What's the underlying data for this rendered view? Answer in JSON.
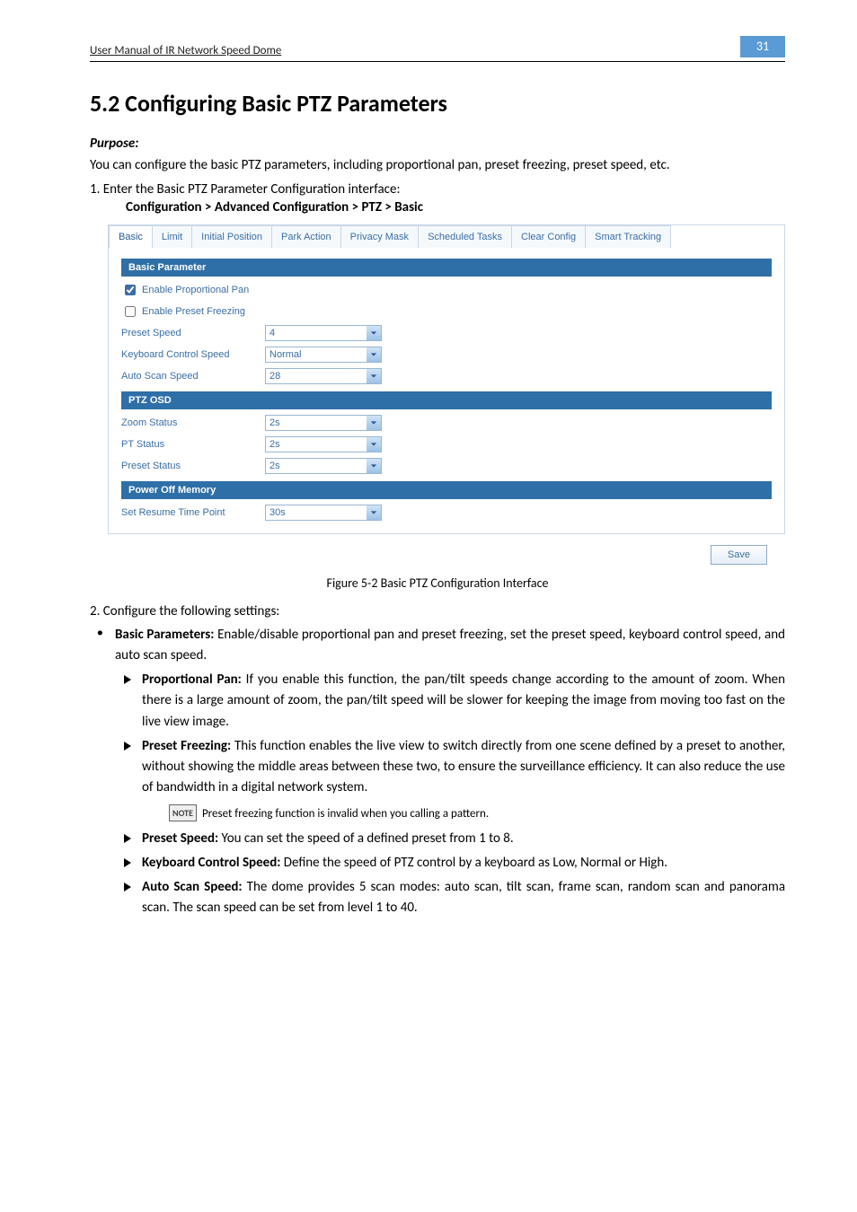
{
  "header": {
    "running": "User Manual of IR Network Speed Dome",
    "page_num": "31"
  },
  "title": "5.2  Configuring Basic PTZ Parameters",
  "purpose_label": "Purpose:",
  "purpose_text": "You can configure the basic PTZ parameters, including proportional pan, preset freezing, preset speed, etc.",
  "step1": "1.   Enter the Basic PTZ Parameter Configuration interface:",
  "breadcrumb": "Configuration > Advanced Configuration > PTZ > Basic",
  "ui": {
    "tabs": [
      "Basic",
      "Limit",
      "Initial Position",
      "Park Action",
      "Privacy Mask",
      "Scheduled Tasks",
      "Clear Config",
      "Smart Tracking"
    ],
    "sections": {
      "basic_param": "Basic Parameter",
      "ptz_osd": "PTZ OSD",
      "power_off": "Power Off Memory"
    },
    "checks": {
      "prop_pan": "Enable Proportional Pan",
      "preset_freeze": "Enable Preset Freezing"
    },
    "rows": {
      "preset_speed": {
        "label": "Preset Speed",
        "value": "4"
      },
      "kb_speed": {
        "label": "Keyboard Control Speed",
        "value": "Normal"
      },
      "auto_scan": {
        "label": "Auto Scan Speed",
        "value": "28"
      },
      "zoom_status": {
        "label": "Zoom Status",
        "value": "2s"
      },
      "pt_status": {
        "label": "PT Status",
        "value": "2s"
      },
      "preset_status": {
        "label": "Preset Status",
        "value": "2s"
      },
      "resume": {
        "label": "Set Resume Time Point",
        "value": "30s"
      }
    },
    "save": "Save"
  },
  "fig_caption": "Figure 5-2 Basic PTZ Configuration Interface",
  "step2": "2.   Configure the following settings:",
  "basic_params_lead": "Basic Parameters:",
  "basic_params_rest": " Enable/disable proportional pan and preset freezing, set the preset speed, keyboard control speed, and auto scan speed.",
  "sub": {
    "prop_pan_lead": "Proportional Pan:",
    "prop_pan_rest": " If you enable this function, the pan/tilt speeds change according to the amount of zoom. When there is a large amount of zoom, the pan/tilt speed will be slower for keeping the image from moving too fast on the live view image.",
    "preset_freeze_lead": "Preset Freezing:",
    "preset_freeze_rest": " This function enables the live view to switch directly from one scene defined by a preset to another, without showing the middle areas between these two, to ensure the surveillance efficiency. It can also reduce the use of bandwidth in a digital network system.",
    "note_label": "NOTE",
    "note_text": "Preset freezing function is invalid when you calling a pattern.",
    "preset_speed_lead": "Preset Speed:",
    "preset_speed_rest": " You can set the speed of a defined preset from 1 to 8.",
    "kb_speed_lead": "Keyboard Control Speed:",
    "kb_speed_rest": " Define the speed of PTZ control by a keyboard as Low, Normal or High.",
    "auto_scan_lead": "Auto Scan Speed:",
    "auto_scan_rest": " The dome provides 5 scan modes: auto scan, tilt scan, frame scan, random scan and panorama scan. The scan speed can be set from level 1 to 40."
  }
}
